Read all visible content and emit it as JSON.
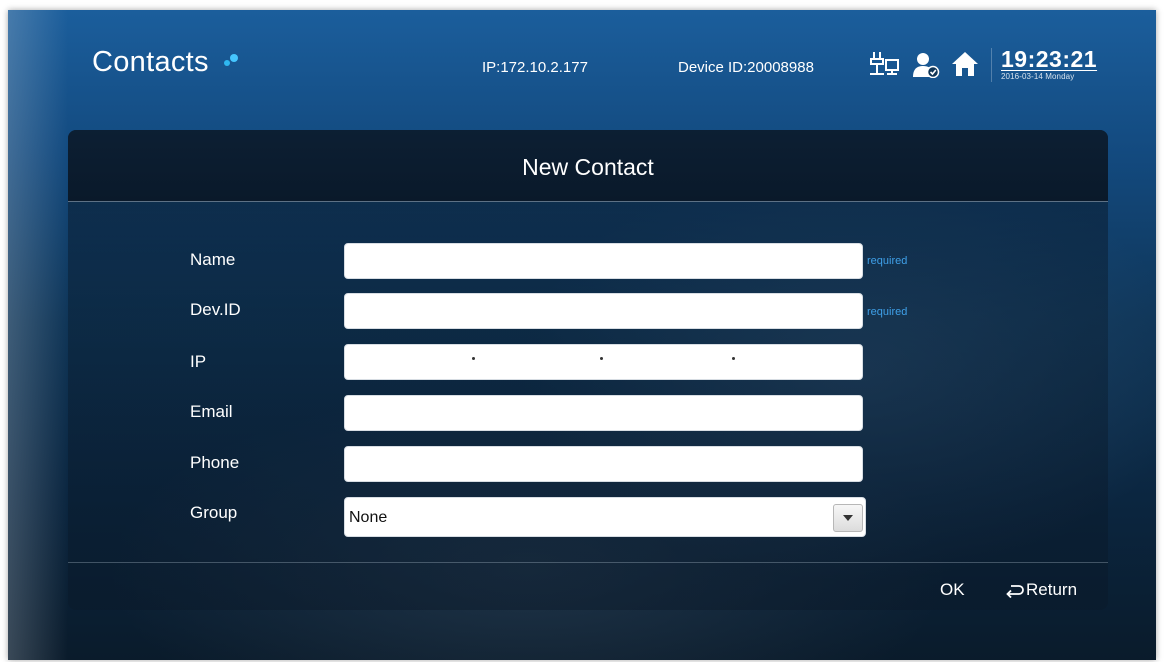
{
  "header": {
    "app_title": "Contacts",
    "ip_label": "IP:172.10.2.177",
    "device_label": "Device ID:20008988",
    "icons": [
      "network-icon",
      "user-status-icon",
      "home-icon"
    ],
    "clock": {
      "time": "19:23:21",
      "date": "2016-03-14 Monday"
    }
  },
  "panel": {
    "title": "New Contact",
    "fields": {
      "name": {
        "label": "Name",
        "value": "",
        "hint": "required"
      },
      "dev_id": {
        "label": "Dev.ID",
        "value": "",
        "hint": "required"
      },
      "ip": {
        "label": "IP",
        "value": ""
      },
      "email": {
        "label": "Email",
        "value": ""
      },
      "phone": {
        "label": "Phone",
        "value": ""
      },
      "group": {
        "label": "Group",
        "value": "None"
      }
    },
    "actions": {
      "ok": "OK",
      "return": "Return"
    }
  },
  "colors": {
    "accent": "#3fa0e8",
    "logo_dot": "#45c6ff",
    "background_top": "#1b5e9c",
    "background_bottom": "#0a1b2b"
  }
}
